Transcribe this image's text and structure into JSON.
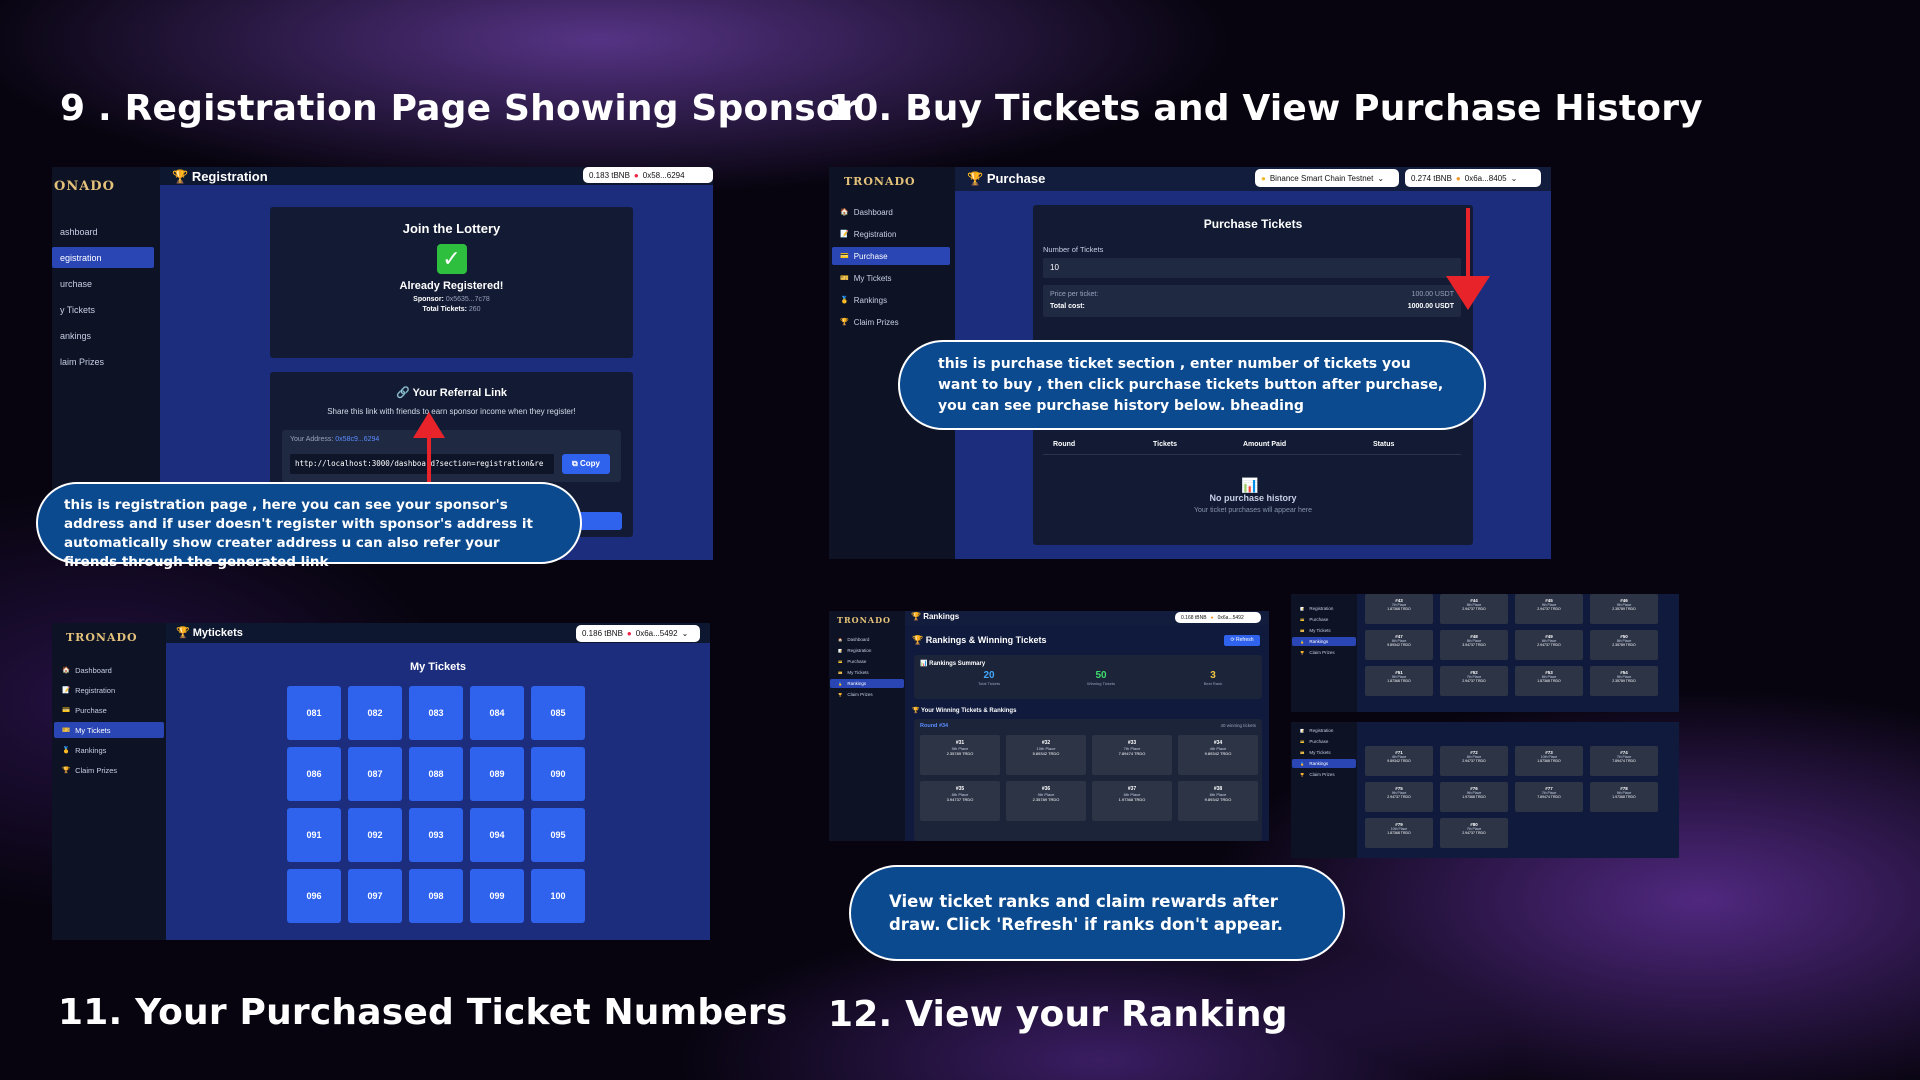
{
  "headings": {
    "h9": "9 . Registration Page Showing Sponsor",
    "h10": "10. Buy Tickets and View Purchase History",
    "h11": "11. Your Purchased Ticket Numbers",
    "h12": "12. View your Ranking"
  },
  "colors": {
    "accent": "#2f63ee",
    "callout": "#0b4a8f",
    "arrow": "#e8242a",
    "background": "#07040f"
  },
  "nav_short": [
    "ashboard",
    "egistration",
    "urchase",
    "y Tickets",
    "ankings",
    "laim Prizes"
  ],
  "nav": [
    "Dashboard",
    "Registration",
    "Purchase",
    "My Tickets",
    "Rankings",
    "Claim Prizes"
  ],
  "reg": {
    "logo": "ONADO",
    "title": "Registration",
    "balance": "0.183 tBNB",
    "address": "0x58...6294",
    "join_title": "Join the Lottery",
    "registered": "Already Registered!",
    "sponsor_label": "Sponsor:",
    "sponsor_value": "0x5635...7c78",
    "tickets_label": "Total Tickets:",
    "tickets_value": "260",
    "referral_title": "🔗 Your Referral Link",
    "share_text": "Share this link with friends to earn sponsor income when they register!",
    "your_address_label": "Your Address:",
    "your_address_value": "0x58c9...6294",
    "link": "http://localhost:3000/dashboard?section=registration&re",
    "copy": "Copy",
    "callout": "this is registration page , here you can see your sponsor's address and if user doesn't register with sponsor's address it automatically show creater address u can also refer your firends through the generated link"
  },
  "purchase": {
    "logo": "TRONADO",
    "title": "Purchase",
    "network": "Binance Smart Chain Testnet",
    "balance": "0.274 tBNB",
    "address": "0x6a...8405",
    "card_title": "Purchase Tickets",
    "num_label": "Number of Tickets",
    "num_value": "10",
    "price_label": "Price per ticket:",
    "price_value": "100.00 USDT",
    "total_label": "Total cost:",
    "total_value": "1000.00 USDT",
    "history_cols": [
      "Round",
      "Tickets",
      "Amount Paid",
      "Status"
    ],
    "no_history": "No purchase history",
    "no_history_sub": "Your ticket purchases will appear here",
    "callout": "this is purchase ticket section , enter number of tickets you want to buy , then click purchase tickets button after purchase, you can see purchase history below. bheading"
  },
  "mytickets": {
    "logo": "TRONADO",
    "title": "Mytickets",
    "balance": "0.186 tBNB",
    "address": "0x6a...5492",
    "card_title": "My Tickets",
    "tickets": [
      "081",
      "082",
      "083",
      "084",
      "085",
      "086",
      "087",
      "088",
      "089",
      "090",
      "091",
      "092",
      "093",
      "094",
      "095",
      "096",
      "097",
      "098",
      "099",
      "100"
    ]
  },
  "rankings": {
    "logo": "TRONADO",
    "title": "Rankings",
    "balance": "0.168 tBNB",
    "address": "0x6a...5492",
    "page_title": "🏆 Rankings & Winning Tickets",
    "refresh": "Refresh",
    "summary_title": "📊 Rankings Summary",
    "summary": [
      {
        "value": "20",
        "label": "Total Tickets",
        "color": "#41a7ff"
      },
      {
        "value": "50",
        "label": "Winning Tickets",
        "color": "#3fdc6e"
      },
      {
        "value": "3",
        "label": "Best Rank",
        "color": "#f4c542"
      }
    ],
    "winning_title": "🏆 Your Winning Tickets & Rankings",
    "round": "Round #34",
    "winning_count": "40 winning tickets",
    "cells": [
      {
        "num": "#31",
        "place": "9th Place",
        "prize": "2.35789 TRDO"
      },
      {
        "num": "#32",
        "place": "10th Place",
        "prize": "5.89342 TRDO"
      },
      {
        "num": "#33",
        "place": "7th Place",
        "prize": "7.89474 TRDO"
      },
      {
        "num": "#34",
        "place": "4th Place",
        "prize": "9.89342 TRDO"
      },
      {
        "num": "#35",
        "place": "8th Place",
        "prize": "3.94737 TRDO"
      },
      {
        "num": "#36",
        "place": "9th Place",
        "prize": "2.35789 TRDO"
      },
      {
        "num": "#37",
        "place": "6th Place",
        "prize": "1.97368 TRDO"
      },
      {
        "num": "#38",
        "place": "8th Place",
        "prize": "9.89342 TRDO"
      }
    ],
    "cells_a": [
      {
        "num": "#43",
        "place": "7th Place",
        "prize": "1.87368 TRDO"
      },
      {
        "num": "#44",
        "place": "8th Place",
        "prize": "2.94737 TRDO"
      },
      {
        "num": "#45",
        "place": "9th Place",
        "prize": "2.94737 TRDO"
      },
      {
        "num": "#46",
        "place": "9th Place",
        "prize": "2.35789 TRDO"
      },
      {
        "num": "#47",
        "place": "6th Place",
        "prize": "9.89342 TRDO"
      },
      {
        "num": "#48",
        "place": "8th Place",
        "prize": "3.94737 TRDO"
      },
      {
        "num": "#49",
        "place": "6th Place",
        "prize": "2.94737 TRDO"
      },
      {
        "num": "#50",
        "place": "8th Place",
        "prize": "2.35789 TRDO"
      },
      {
        "num": "#51",
        "place": "9th Place",
        "prize": "1.87368 TRDO"
      },
      {
        "num": "#52",
        "place": "7th Place",
        "prize": "2.94737 TRDO"
      },
      {
        "num": "#53",
        "place": "6th Place",
        "prize": "1.87368 TRDO"
      },
      {
        "num": "#54",
        "place": "9th Place",
        "prize": "2.35789 TRDO"
      }
    ],
    "cells_b": [
      {
        "num": "#71",
        "place": "4th Place",
        "prize": "9.89342 TRDO"
      },
      {
        "num": "#72",
        "place": "6th Place",
        "prize": "2.94737 TRDO"
      },
      {
        "num": "#73",
        "place": "10th Place",
        "prize": "1.87368 TRDO"
      },
      {
        "num": "#74",
        "place": "7th Place",
        "prize": "7.89474 TRDO"
      },
      {
        "num": "#75",
        "place": "9th Place",
        "prize": "2.94737 TRDO"
      },
      {
        "num": "#76",
        "place": "9th Place",
        "prize": "1.97368 TRDO"
      },
      {
        "num": "#77",
        "place": "7th Place",
        "prize": "7.89474 TRDO"
      },
      {
        "num": "#78",
        "place": "9th Place",
        "prize": "1.97368 TRDO"
      },
      {
        "num": "#79",
        "place": "10th Place",
        "prize": "1.87368 TRDO"
      },
      {
        "num": "#80",
        "place": "7th Place",
        "prize": "2.94737 TRDO"
      }
    ],
    "callout": "View ticket ranks and claim rewards after draw. Click 'Refresh' if ranks don't appear."
  }
}
